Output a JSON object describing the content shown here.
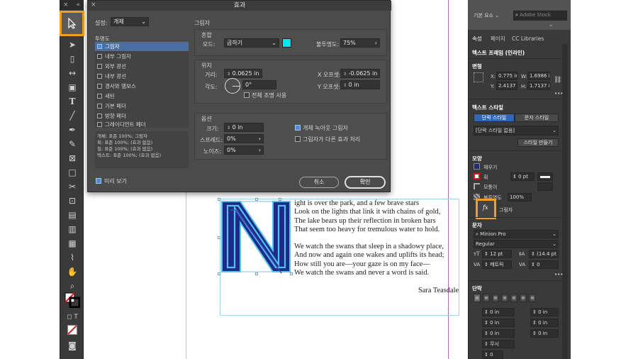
{
  "document": {
    "poem_lines": [
      "ight is over the park, and a few brave stars",
      "Look on the lights that link it with chains of gold,",
      "The lake bears up their reflection in broken bars",
      "That seem too heavy for tremulous water to hold.",
      "",
      "We watch the swans that sleep in a shadowy place,",
      "And now and again one wakes and uplifts its head;",
      "How still you are—your gaze is on my face—",
      "We watch the swans and never a word is said."
    ],
    "author": "Sara Teasdale",
    "drop_cap": "N"
  },
  "tools_panel": {
    "collapse": "«",
    "close": "×"
  },
  "dialog": {
    "title": "효과",
    "close": "×",
    "settings_label": "설정:",
    "settings_value": "개체",
    "transparency_label": "투명도",
    "effects": [
      {
        "label": "그림자",
        "checked": true,
        "selected": true
      },
      {
        "label": "내부 그림자",
        "checked": false
      },
      {
        "label": "외부 광선",
        "checked": false
      },
      {
        "label": "내부 광선",
        "checked": false
      },
      {
        "label": "경사와 엠보스",
        "checked": false
      },
      {
        "label": "새틴",
        "checked": false
      },
      {
        "label": "기본 페더",
        "checked": false
      },
      {
        "label": "방향 페더",
        "checked": false
      },
      {
        "label": "그레이디언트 페더",
        "checked": false
      }
    ],
    "summary": [
      "개체: 표준 100%; 그림자",
      "획: 표준 100%; (효과 없음)",
      "칠: 표준 100%; (효과 없음)",
      "텍스트: 표준 100%; (효과 없음)"
    ],
    "preview_label": "미리 보기",
    "section_title": "그림자",
    "blending": {
      "title": "혼합",
      "mode_label": "모드:",
      "mode_value": "곱하기",
      "color": "#00e5f0",
      "opacity_label": "불투명도:",
      "opacity_value": "75%"
    },
    "position": {
      "title": "위치",
      "distance_label": "거리:",
      "distance_value": "0.0625 in",
      "x_offset_label": "X 오프셋:",
      "x_offset_value": "-0.0625 in",
      "angle_label": "각도:",
      "angle_value": "0°",
      "y_offset_label": "Y 오프셋:",
      "y_offset_value": "0 in",
      "global_light_label": "전체 조명 사용"
    },
    "options": {
      "title": "옵션",
      "size_label": "크기:",
      "size_value": "0 in",
      "spread_label": "스프레드:",
      "spread_value": "0%",
      "noise_label": "노이즈:",
      "noise_value": "0%",
      "knockout_label": "개체 녹아웃 그림자",
      "other_effects_label": "그림자가 다른 효과 처리"
    },
    "cancel_label": "취소",
    "ok_label": "확인"
  },
  "right_panel": {
    "workspace": "기본 요소",
    "search_placeholder": "Adobe Stock",
    "tabs": [
      "속성",
      "페이지",
      "CC Libraries"
    ],
    "frame_type": "텍스트 프레임 (인라인)",
    "transform_title": "변형",
    "x_label": "X:",
    "x_value": "0.775 in",
    "y_label": "Y:",
    "y_value": "2.4137 in",
    "w_label": "W:",
    "w_value": "1.6986 in",
    "h_label": "H:",
    "h_value": "1.7137 in",
    "more": "•••",
    "text_style_title": "텍스트 스타일",
    "para_style_tab": "단락 스타일",
    "char_style_tab": "문자 스타일",
    "para_style_value": "[단락 스타일 없음]",
    "create_style_btn": "스타일 만들기",
    "appearance_title": "모양",
    "fill_label": "채우기",
    "stroke_label": "획",
    "stroke_weight": "0 pt",
    "corner_label": "모퉁이",
    "opacity_label": "불투명도",
    "opacity_value": "100%",
    "fx_label": "fx",
    "shadow_label": "그림자",
    "character_title": "문자",
    "font_family": "Minion Pro",
    "font_style": "Regular",
    "font_size": "12 pt",
    "leading": "(14.4 pt",
    "kerning": "메트릭",
    "tracking": "0",
    "paragraph_title": "단락",
    "indent_values": [
      "0 in",
      "0 in",
      "0 in",
      "0 in",
      "0 in",
      "0 in"
    ],
    "drop_cap_value": "무시",
    "drop_lines": "0",
    "highlight_color": "#f0a020"
  }
}
